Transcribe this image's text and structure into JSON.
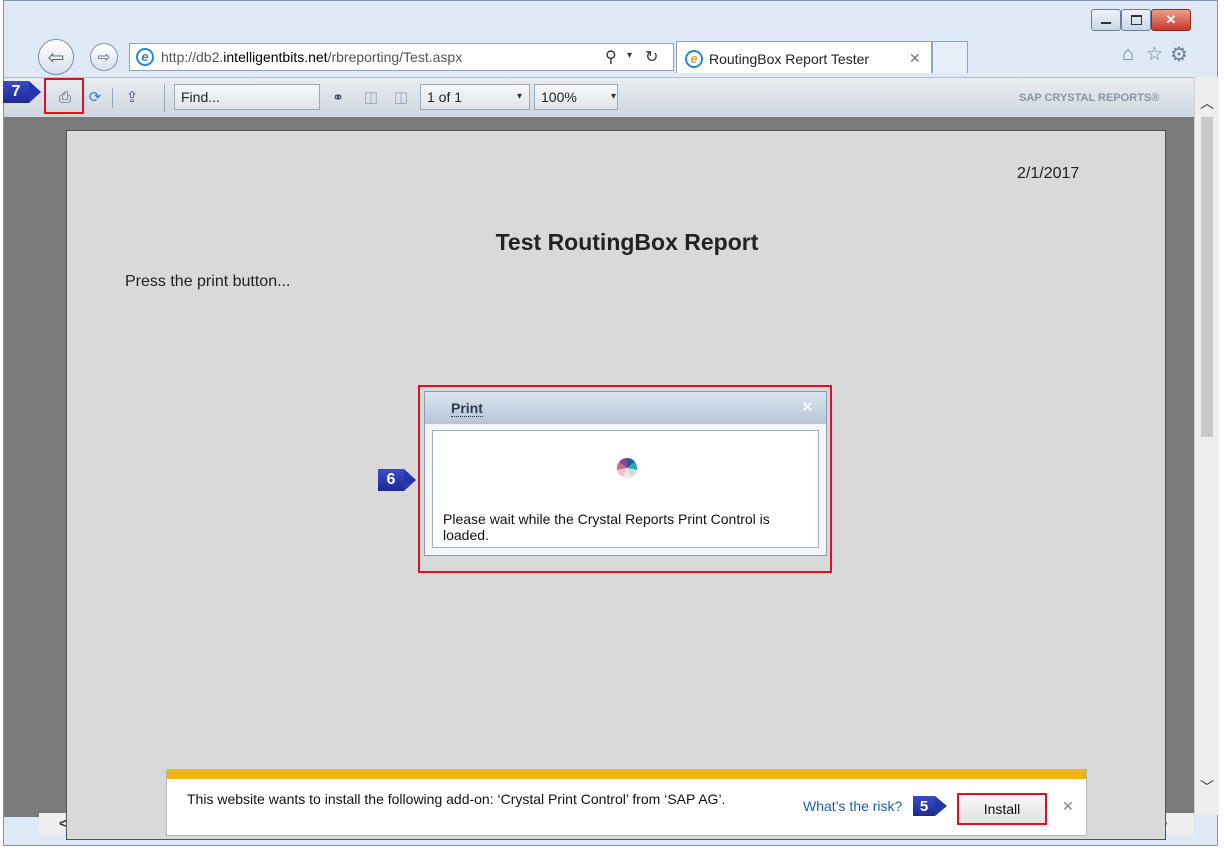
{
  "browser": {
    "address": {
      "prefix": "http://db2.",
      "domain": "intelligentbits.net",
      "path": "/rbreporting/Test.aspx"
    },
    "tab_title": "RoutingBox Report Tester"
  },
  "toolbar": {
    "find_placeholder": "Find...",
    "page_select": "1 of 1",
    "zoom_select": "100%",
    "brand": "SAP CRYSTAL REPORTS®"
  },
  "report": {
    "date": "2/1/2017",
    "title": "Test RoutingBox Report",
    "instruction": "Press the print button..."
  },
  "print_dialog": {
    "title": "Print",
    "message": "Please wait while the Crystal Reports Print Control is loaded."
  },
  "notification": {
    "message": "This website wants to install the following add-on: ‘Crystal Print Control’ from ‘SAP AG’.",
    "risk_link": "What’s the risk?",
    "install_label": "Install"
  },
  "markers": {
    "print": "7",
    "dialog": "6",
    "install": "5"
  },
  "colors": {
    "highlight": "#e0101e",
    "marker": "#2535ac",
    "notification_bar": "#f2b411",
    "link": "#1a5fb4"
  }
}
